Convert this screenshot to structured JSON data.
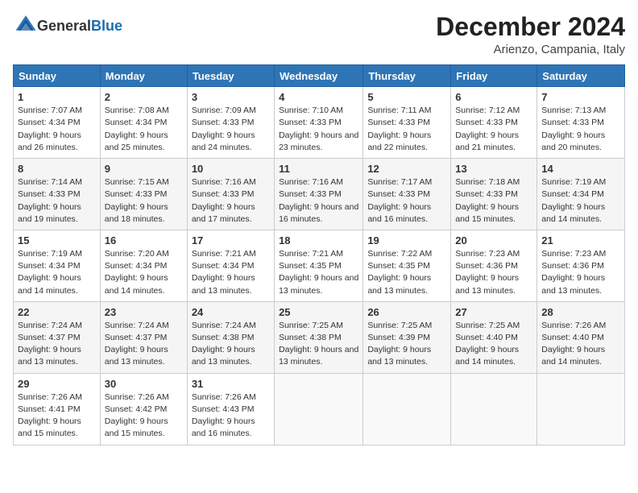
{
  "header": {
    "logo_general": "General",
    "logo_blue": "Blue",
    "month_title": "December 2024",
    "subtitle": "Arienzo, Campania, Italy"
  },
  "days_of_week": [
    "Sunday",
    "Monday",
    "Tuesday",
    "Wednesday",
    "Thursday",
    "Friday",
    "Saturday"
  ],
  "weeks": [
    [
      {
        "day": 1,
        "sunrise": "7:07 AM",
        "sunset": "4:34 PM",
        "daylight": "9 hours and 26 minutes."
      },
      {
        "day": 2,
        "sunrise": "7:08 AM",
        "sunset": "4:34 PM",
        "daylight": "9 hours and 25 minutes."
      },
      {
        "day": 3,
        "sunrise": "7:09 AM",
        "sunset": "4:33 PM",
        "daylight": "9 hours and 24 minutes."
      },
      {
        "day": 4,
        "sunrise": "7:10 AM",
        "sunset": "4:33 PM",
        "daylight": "9 hours and 23 minutes."
      },
      {
        "day": 5,
        "sunrise": "7:11 AM",
        "sunset": "4:33 PM",
        "daylight": "9 hours and 22 minutes."
      },
      {
        "day": 6,
        "sunrise": "7:12 AM",
        "sunset": "4:33 PM",
        "daylight": "9 hours and 21 minutes."
      },
      {
        "day": 7,
        "sunrise": "7:13 AM",
        "sunset": "4:33 PM",
        "daylight": "9 hours and 20 minutes."
      }
    ],
    [
      {
        "day": 8,
        "sunrise": "7:14 AM",
        "sunset": "4:33 PM",
        "daylight": "9 hours and 19 minutes."
      },
      {
        "day": 9,
        "sunrise": "7:15 AM",
        "sunset": "4:33 PM",
        "daylight": "9 hours and 18 minutes."
      },
      {
        "day": 10,
        "sunrise": "7:16 AM",
        "sunset": "4:33 PM",
        "daylight": "9 hours and 17 minutes."
      },
      {
        "day": 11,
        "sunrise": "7:16 AM",
        "sunset": "4:33 PM",
        "daylight": "9 hours and 16 minutes."
      },
      {
        "day": 12,
        "sunrise": "7:17 AM",
        "sunset": "4:33 PM",
        "daylight": "9 hours and 16 minutes."
      },
      {
        "day": 13,
        "sunrise": "7:18 AM",
        "sunset": "4:33 PM",
        "daylight": "9 hours and 15 minutes."
      },
      {
        "day": 14,
        "sunrise": "7:19 AM",
        "sunset": "4:34 PM",
        "daylight": "9 hours and 14 minutes."
      }
    ],
    [
      {
        "day": 15,
        "sunrise": "7:19 AM",
        "sunset": "4:34 PM",
        "daylight": "9 hours and 14 minutes."
      },
      {
        "day": 16,
        "sunrise": "7:20 AM",
        "sunset": "4:34 PM",
        "daylight": "9 hours and 14 minutes."
      },
      {
        "day": 17,
        "sunrise": "7:21 AM",
        "sunset": "4:34 PM",
        "daylight": "9 hours and 13 minutes."
      },
      {
        "day": 18,
        "sunrise": "7:21 AM",
        "sunset": "4:35 PM",
        "daylight": "9 hours and 13 minutes."
      },
      {
        "day": 19,
        "sunrise": "7:22 AM",
        "sunset": "4:35 PM",
        "daylight": "9 hours and 13 minutes."
      },
      {
        "day": 20,
        "sunrise": "7:23 AM",
        "sunset": "4:36 PM",
        "daylight": "9 hours and 13 minutes."
      },
      {
        "day": 21,
        "sunrise": "7:23 AM",
        "sunset": "4:36 PM",
        "daylight": "9 hours and 13 minutes."
      }
    ],
    [
      {
        "day": 22,
        "sunrise": "7:24 AM",
        "sunset": "4:37 PM",
        "daylight": "9 hours and 13 minutes."
      },
      {
        "day": 23,
        "sunrise": "7:24 AM",
        "sunset": "4:37 PM",
        "daylight": "9 hours and 13 minutes."
      },
      {
        "day": 24,
        "sunrise": "7:24 AM",
        "sunset": "4:38 PM",
        "daylight": "9 hours and 13 minutes."
      },
      {
        "day": 25,
        "sunrise": "7:25 AM",
        "sunset": "4:38 PM",
        "daylight": "9 hours and 13 minutes."
      },
      {
        "day": 26,
        "sunrise": "7:25 AM",
        "sunset": "4:39 PM",
        "daylight": "9 hours and 13 minutes."
      },
      {
        "day": 27,
        "sunrise": "7:25 AM",
        "sunset": "4:40 PM",
        "daylight": "9 hours and 14 minutes."
      },
      {
        "day": 28,
        "sunrise": "7:26 AM",
        "sunset": "4:40 PM",
        "daylight": "9 hours and 14 minutes."
      }
    ],
    [
      {
        "day": 29,
        "sunrise": "7:26 AM",
        "sunset": "4:41 PM",
        "daylight": "9 hours and 15 minutes."
      },
      {
        "day": 30,
        "sunrise": "7:26 AM",
        "sunset": "4:42 PM",
        "daylight": "9 hours and 15 minutes."
      },
      {
        "day": 31,
        "sunrise": "7:26 AM",
        "sunset": "4:43 PM",
        "daylight": "9 hours and 16 minutes."
      },
      null,
      null,
      null,
      null
    ]
  ]
}
